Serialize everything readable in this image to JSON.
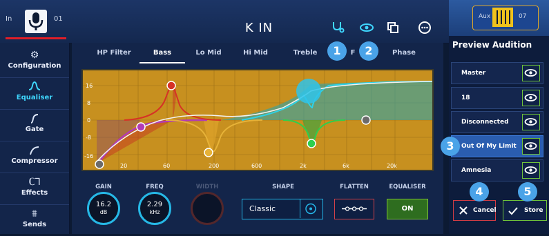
{
  "channel": {
    "in_label": "In",
    "number": "01",
    "name": "K IN"
  },
  "aux": {
    "label": "Aux",
    "number": "07"
  },
  "sidebar": {
    "items": [
      {
        "label": "Configuration",
        "icon": "configuration-icon"
      },
      {
        "label": "Equaliser",
        "icon": "equaliser-icon",
        "active": true
      },
      {
        "label": "Gate",
        "icon": "gate-icon"
      },
      {
        "label": "Compressor",
        "icon": "compressor-icon"
      },
      {
        "label": "Effects",
        "icon": "effects-icon"
      },
      {
        "label": "Sends",
        "icon": "sends-icon"
      }
    ]
  },
  "tabs": [
    "HP Filter",
    "Bass",
    "Lo Mid",
    "Hi Mid",
    "Treble",
    "F",
    "Phase"
  ],
  "active_tab": "Bass",
  "graph": {
    "y_ticks": [
      "16",
      "8",
      "0",
      "-8",
      "-16"
    ],
    "x_ticks": [
      "20",
      "60",
      "200",
      "600",
      "2k",
      "6k",
      "20k"
    ]
  },
  "controls": {
    "gain_label": "GAIN",
    "gain_value": "16.2",
    "gain_unit": "dB",
    "freq_label": "FREQ",
    "freq_value": "2.29",
    "freq_unit": "kHz",
    "width_label": "WIDTH",
    "shape_label": "SHAPE",
    "shape_value": "Classic",
    "flatten_label": "FLATTEN",
    "equaliser_label": "EQUALISER",
    "equaliser_value": "ON"
  },
  "preview": {
    "title": "Preview Audition",
    "items": [
      "Master",
      "18",
      "Disconnected",
      "Out Of My Limit",
      "Amnesia"
    ],
    "selected": "Out Of My Limit",
    "cancel_label": "Cancel",
    "store_label": "Store"
  },
  "badges": [
    "1",
    "2",
    "3",
    "4",
    "5"
  ],
  "colors": {
    "accent": "#3fd7ff",
    "graph_bg": "#c7901f",
    "active_green": "#2e6d1f",
    "cancel_red": "#d23c44"
  }
}
